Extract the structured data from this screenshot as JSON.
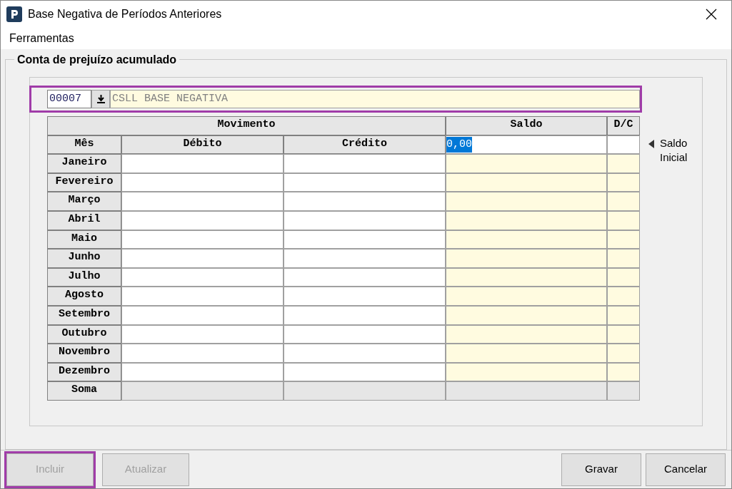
{
  "window": {
    "title": "Base Negativa de Períodos Anteriores"
  },
  "menu": [
    {
      "label": "Ferramentas"
    }
  ],
  "group": {
    "title": "Conta de prejuízo acumulado"
  },
  "account": {
    "code": "00007",
    "name": "CSLL BASE NEGATIVA",
    "highlighted": true
  },
  "table": {
    "group_headers": [
      "Movimento",
      "Saldo",
      "D/C"
    ],
    "columns": [
      "Mês",
      "Débito",
      "Crédito"
    ],
    "initial_balance": {
      "value": "0,00",
      "selected": true
    },
    "rows": [
      {
        "month": "Janeiro"
      },
      {
        "month": "Fevereiro"
      },
      {
        "month": "Março"
      },
      {
        "month": "Abril"
      },
      {
        "month": "Maio"
      },
      {
        "month": "Junho"
      },
      {
        "month": "Julho"
      },
      {
        "month": "Agosto"
      },
      {
        "month": "Setembro"
      },
      {
        "month": "Outubro"
      },
      {
        "month": "Novembro"
      },
      {
        "month": "Dezembro"
      }
    ],
    "total_label": "Soma"
  },
  "side_note": "Saldo Inicial",
  "left_buttons": [
    {
      "label": "Incluir",
      "disabled": true,
      "highlighted": true
    },
    {
      "label": "Atualizar",
      "disabled": true,
      "highlighted": false
    }
  ],
  "right_buttons": [
    {
      "label": "Gravar",
      "disabled": false,
      "highlighted": false
    },
    {
      "label": "Cancelar",
      "disabled": false,
      "highlighted": false
    }
  ]
}
